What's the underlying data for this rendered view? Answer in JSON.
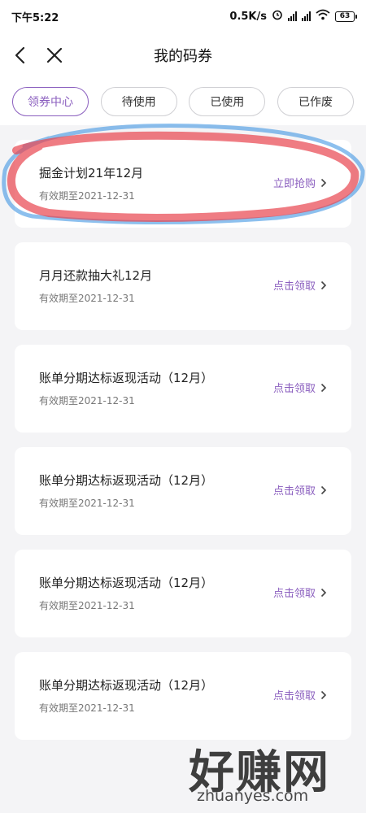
{
  "status": {
    "time": "下午5:22",
    "speed": "0.5K/s",
    "battery": "63"
  },
  "header": {
    "title": "我的码券",
    "back_icon": "chevron-left-icon",
    "close_icon": "close-icon"
  },
  "tabs": [
    {
      "label": "领券中心",
      "active": true
    },
    {
      "label": "待使用",
      "active": false
    },
    {
      "label": "已使用",
      "active": false
    },
    {
      "label": "已作废",
      "active": false
    }
  ],
  "coupons": [
    {
      "title": "掘金计划21年12月",
      "validity": "有效期至2021-12-31",
      "action": "立即抢购"
    },
    {
      "title": "月月还款抽大礼12月",
      "validity": "有效期至2021-12-31",
      "action": "点击领取"
    },
    {
      "title": "账单分期达标返现活动（12月）",
      "validity": "有效期至2021-12-31",
      "action": "点击领取"
    },
    {
      "title": "账单分期达标返现活动（12月）",
      "validity": "有效期至2021-12-31",
      "action": "点击领取"
    },
    {
      "title": "账单分期达标返现活动（12月）",
      "validity": "有效期至2021-12-31",
      "action": "点击领取"
    },
    {
      "title": "账单分期达标返现活动（12月）",
      "validity": "有效期至2021-12-31",
      "action": "点击领取"
    }
  ],
  "watermark": {
    "main": "好赚网",
    "sub": "zhuanyes.com"
  },
  "colors": {
    "accent": "#8b5fbf",
    "annotation_red": "#e8454f",
    "annotation_blue": "#2f8de0"
  }
}
